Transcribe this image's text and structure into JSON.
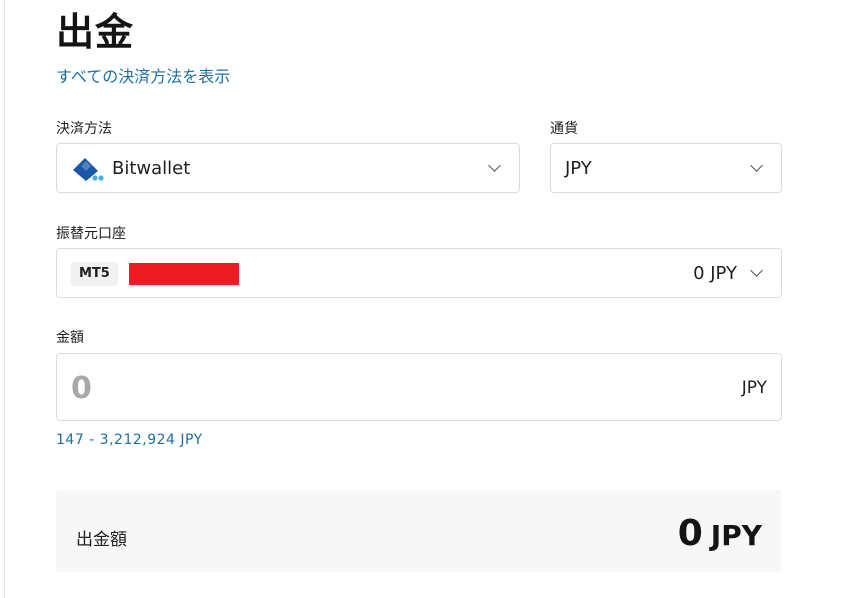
{
  "page": {
    "title": "出金",
    "all_methods_link": "すべての決済方法を表示"
  },
  "payment_method": {
    "label": "決済方法",
    "selected": "Bitwallet",
    "icon": "bitwallet-logo-icon"
  },
  "currency": {
    "label": "通貨",
    "selected": "JPY"
  },
  "source_account": {
    "label": "振替元口座",
    "platform_badge": "MT5",
    "balance": "0 JPY"
  },
  "amount": {
    "label": "金額",
    "placeholder": "0",
    "value": "",
    "unit": "JPY",
    "range_hint": "147 - 3,212,924 JPY"
  },
  "summary": {
    "label": "出金額",
    "amount": "0",
    "unit": "JPY"
  },
  "colors": {
    "link": "#1d6fa8",
    "redaction": "#ed1c24",
    "summary_bg": "#f7f7f7",
    "logo_blue": "#1a56a8",
    "logo_accent": "#3fb1e6"
  }
}
